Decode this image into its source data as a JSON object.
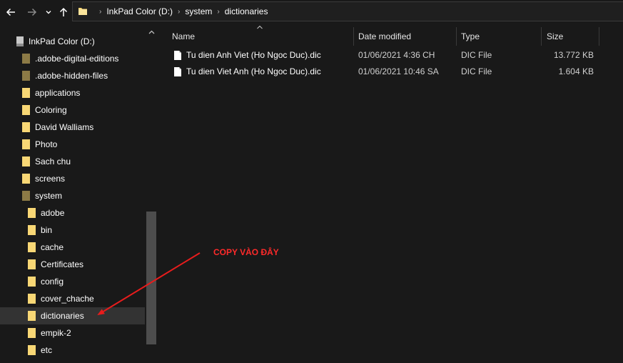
{
  "address_bar": {
    "crumbs": [
      "InkPad Color (D:)",
      "system",
      "dictionaries"
    ]
  },
  "sidebar": {
    "root": "InkPad Color (D:)",
    "top_items": [
      ".adobe-digital-editions",
      ".adobe-hidden-files",
      "applications",
      "Coloring",
      "David Walliams",
      "Photo",
      "Sach chu",
      "screens",
      "system"
    ],
    "system_children": [
      "adobe",
      "bin",
      "cache",
      "Certificates",
      "config",
      "cover_chache",
      "dictionaries",
      "empik-2",
      "etc"
    ],
    "selected": "dictionaries"
  },
  "columns": {
    "name": "Name",
    "date": "Date modified",
    "type": "Type",
    "size": "Size"
  },
  "files": [
    {
      "name": "Tu dien Anh Viet (Ho Ngoc Duc).dic",
      "date": "01/06/2021 4:36 CH",
      "type": "DIC File",
      "size": "13.772 KB"
    },
    {
      "name": "Tu dien Viet Anh (Ho Ngoc Duc).dic",
      "date": "01/06/2021 10:46 SA",
      "type": "DIC File",
      "size": "1.604 KB"
    }
  ],
  "annotation": {
    "text": "COPY VÀO ĐÂY",
    "color": "#e81c1c"
  },
  "colors": {
    "background": "#191919",
    "selected_row": "#333333",
    "folder_yellow": "#f8d775",
    "hidden_folder": "#8c7a46"
  }
}
